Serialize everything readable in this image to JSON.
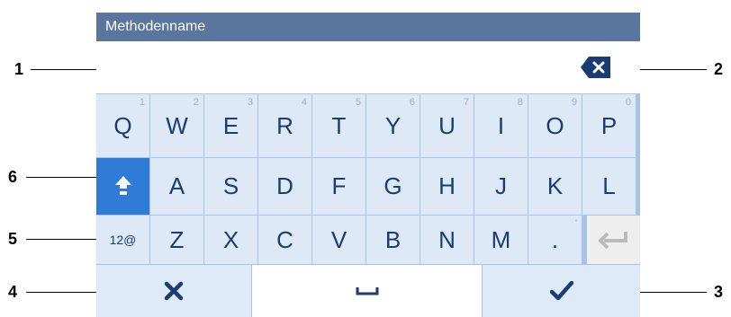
{
  "dialog": {
    "title": "Methodenname",
    "input_value": ""
  },
  "keyboard": {
    "row1": [
      {
        "char": "Q",
        "num": "1"
      },
      {
        "char": "W",
        "num": "2"
      },
      {
        "char": "E",
        "num": "3"
      },
      {
        "char": "R",
        "num": "4"
      },
      {
        "char": "T",
        "num": "5"
      },
      {
        "char": "Y",
        "num": "6"
      },
      {
        "char": "U",
        "num": "7"
      },
      {
        "char": "I",
        "num": "8"
      },
      {
        "char": "O",
        "num": "9"
      },
      {
        "char": "P",
        "num": "0"
      }
    ],
    "row2": [
      "A",
      "S",
      "D",
      "F",
      "G",
      "H",
      "J",
      "K",
      "L"
    ],
    "row3": [
      "Z",
      "X",
      "C",
      "V",
      "B",
      "N",
      "M",
      "."
    ],
    "row3_dot_alt": "'",
    "mode_switch_label": "12@",
    "icons": {
      "shift": "shift-arrow-icon",
      "backspace": "backspace-icon",
      "enter": "enter-icon",
      "cancel": "cancel-x-icon",
      "space": "space-icon",
      "confirm": "checkmark-icon"
    }
  },
  "callouts": [
    "1",
    "2",
    "3",
    "4",
    "5",
    "6"
  ],
  "colors": {
    "accent": "#5a759e",
    "key_bg": "#dde9f7",
    "key_text": "#1c3b73",
    "grid": "#a9c3e2"
  }
}
